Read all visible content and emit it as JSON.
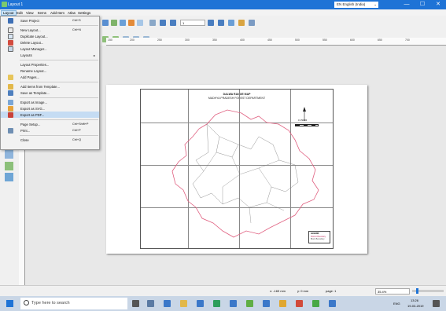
{
  "titlebar": {
    "title": "Layout 1",
    "language": "EN English (India)",
    "min": "—",
    "max": "☐",
    "close": "✕"
  },
  "menubar": [
    "Layout",
    "Edit",
    "View",
    "Items",
    "Add Item",
    "Atlas",
    "Settings"
  ],
  "layout_menu": {
    "items": [
      {
        "label": "Save Project",
        "shortcut": "Ctrl+S",
        "icon": "save-icon"
      },
      {
        "label": "New Layout...",
        "shortcut": "Ctrl+N",
        "icon": "new-layout-icon"
      },
      {
        "label": "Duplicate Layout...",
        "shortcut": "",
        "icon": "duplicate-icon"
      },
      {
        "label": "Delete Layout...",
        "shortcut": "",
        "icon": "delete-icon"
      },
      {
        "label": "Layout Manager...",
        "shortcut": "",
        "icon": "layout-manager-icon"
      },
      {
        "label": "Layouts",
        "shortcut": "▸",
        "icon": ""
      },
      {
        "label": "Layout Properties...",
        "shortcut": "",
        "icon": ""
      },
      {
        "label": "Rename Layout...",
        "shortcut": "",
        "icon": ""
      },
      {
        "label": "Add Pages...",
        "shortcut": "",
        "icon": "add-pages-icon"
      },
      {
        "label": "Add Items from Template...",
        "shortcut": "",
        "icon": "folder-icon"
      },
      {
        "label": "Save as Template...",
        "shortcut": "",
        "icon": "template-icon"
      },
      {
        "label": "Export as Image...",
        "shortcut": "",
        "icon": "export-image-icon"
      },
      {
        "label": "Export as SVG...",
        "shortcut": "",
        "icon": "export-svg-icon"
      },
      {
        "label": "Export as PDF...",
        "shortcut": "",
        "icon": "export-pdf-icon"
      },
      {
        "label": "Page Setup...",
        "shortcut": "Ctrl+Shift+P",
        "icon": ""
      },
      {
        "label": "Print...",
        "shortcut": "Ctrl+P",
        "icon": "print-icon"
      },
      {
        "label": "Close",
        "shortcut": "Ctrl+Q",
        "icon": ""
      }
    ]
  },
  "page_field": "1",
  "ruler_ticks": [
    "150",
    "200",
    "250",
    "300",
    "350",
    "400",
    "450",
    "500",
    "550",
    "600",
    "650",
    "700"
  ],
  "map": {
    "title1": "DALWA RANGE MAP",
    "title2": "MADHYA PRADESH FOREST DEPARTMENT",
    "legend_title": "LEGEND",
    "legend_items": [
      "District Boundary",
      "Block Boundary"
    ],
    "scale_label": "0 1:50000"
  },
  "statusbar": {
    "x": "x: -169 mm",
    "y": "y: 0 mm",
    "page": "page: 1",
    "zoom": "35.4%"
  },
  "taskbar": {
    "search_placeholder": "Type here to search",
    "time": "13:26",
    "date": "19-03-2019",
    "lang": "ENG"
  },
  "colors": {
    "titlebar": "#1e73d6",
    "highlight": "#c5dcf3",
    "map_boundary": "#e06080"
  }
}
